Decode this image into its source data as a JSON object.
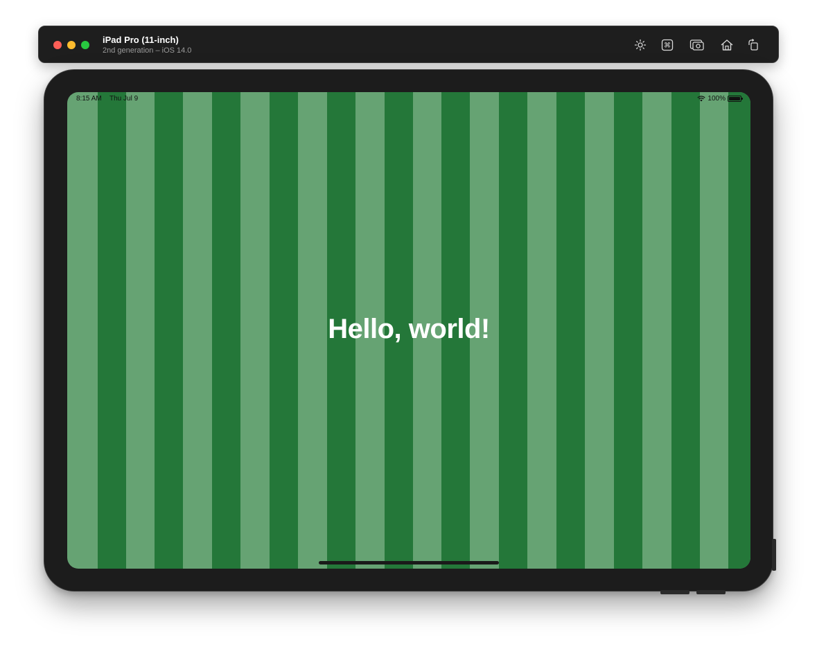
{
  "window": {
    "device_name": "iPad Pro (11-inch)",
    "device_subtitle": "2nd generation – iOS 14.0",
    "traffic_lights": {
      "close_color": "#fe5f57",
      "minimize_color": "#febc2e",
      "maximize_color": "#28c840"
    },
    "toolbar": [
      {
        "name": "brightness-icon",
        "label": "Brightness"
      },
      {
        "name": "command-icon",
        "label": "Command"
      },
      {
        "name": "screenshot-icon",
        "label": "Screenshot"
      },
      {
        "name": "home-icon",
        "label": "Home"
      },
      {
        "name": "rotate-icon",
        "label": "Rotate"
      }
    ]
  },
  "status_bar": {
    "time": "8:15 AM",
    "date": "Thu Jul 9",
    "battery": "100%",
    "wifi_icon": "wifi-icon",
    "battery_icon": "battery-full-icon"
  },
  "screen": {
    "message": "Hello, world!",
    "stripe_colors": {
      "light": "#66a373",
      "dark": "#247739"
    }
  }
}
